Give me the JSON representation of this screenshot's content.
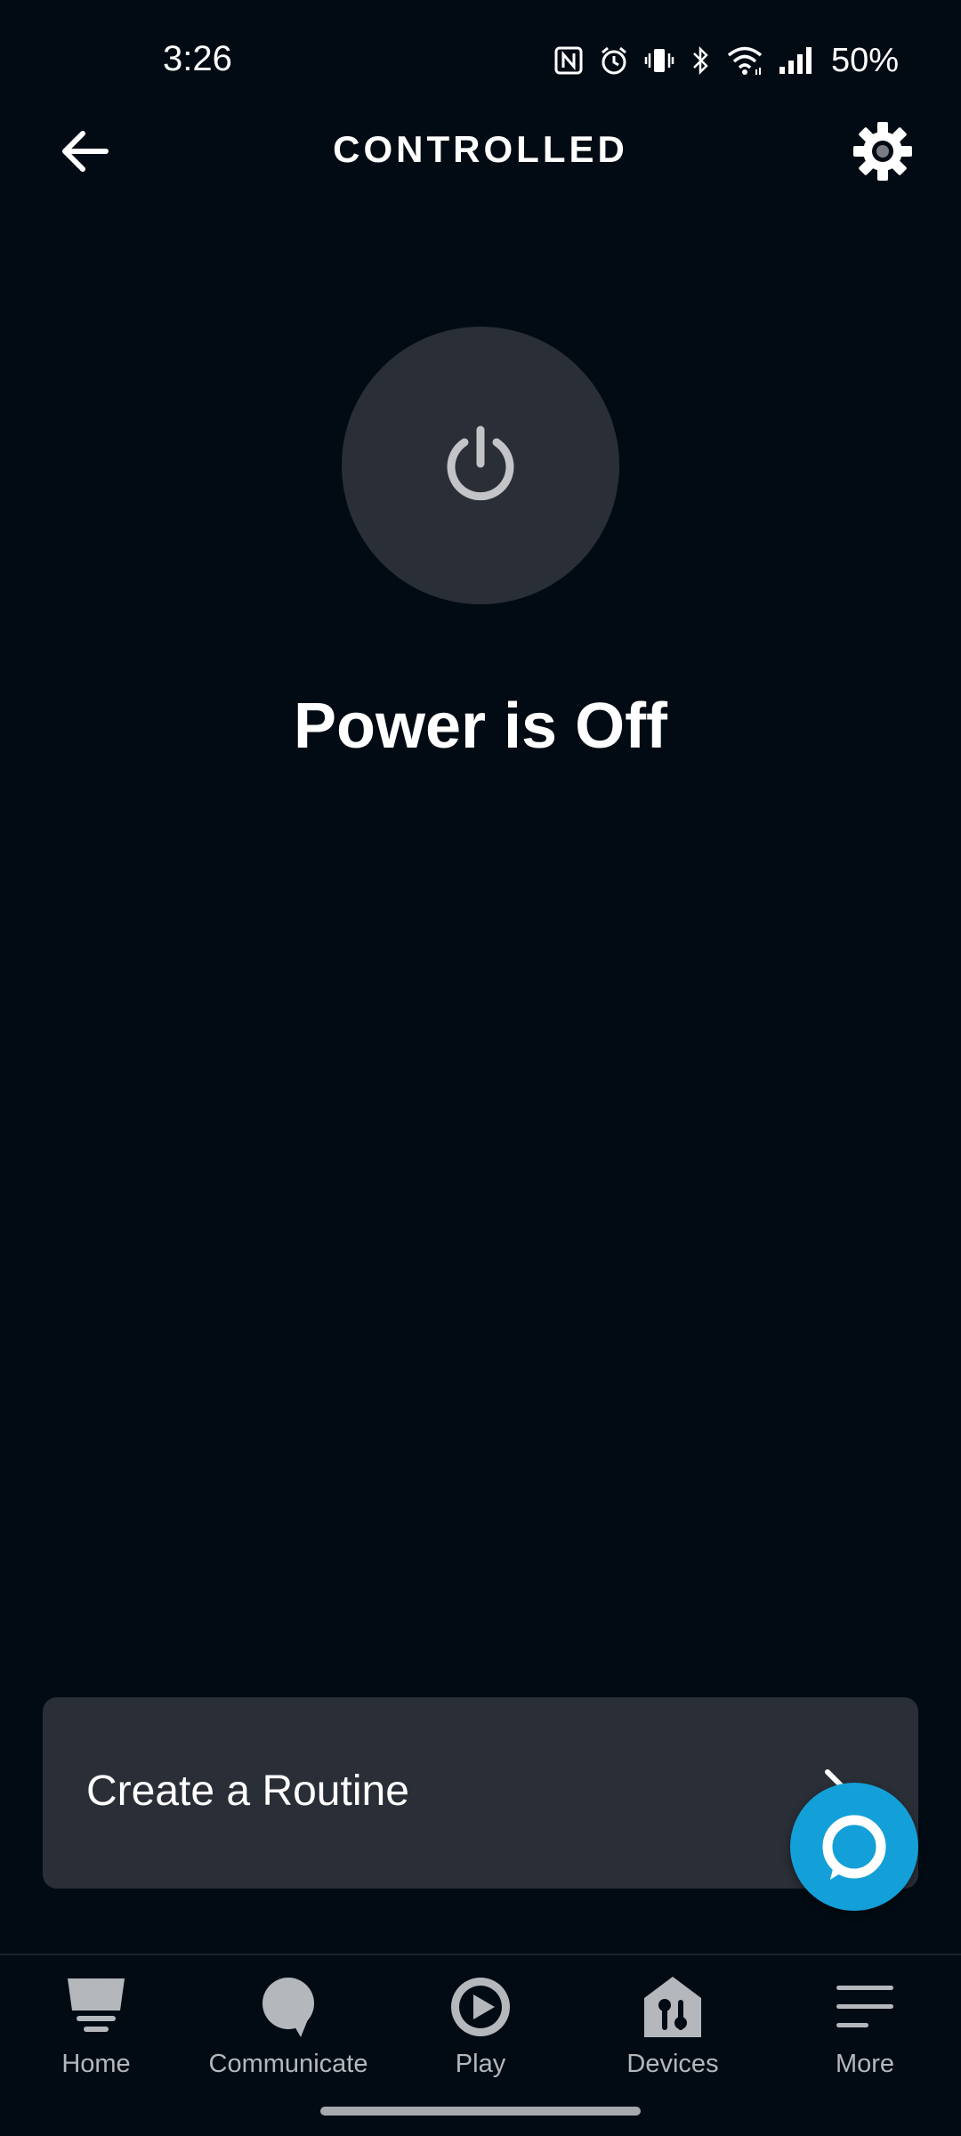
{
  "status_bar": {
    "time": "3:26",
    "battery": "50%",
    "icons": [
      "nfc-icon",
      "alarm-icon",
      "vibrate-icon",
      "bluetooth-icon",
      "wifi-icon",
      "signal-icon"
    ]
  },
  "header": {
    "title": "CONTROLLED",
    "back_icon": "back-arrow-icon",
    "settings_icon": "gear-icon"
  },
  "power": {
    "icon": "power-icon",
    "status": "Power is Off"
  },
  "routine_card": {
    "label": "Create a Routine",
    "chevron_icon": "chevron-right-icon"
  },
  "alexa_button": {
    "icon": "alexa-icon",
    "color": "#13a0d8"
  },
  "bottom_nav": {
    "items": [
      {
        "label": "Home",
        "icon": "home-icon"
      },
      {
        "label": "Communicate",
        "icon": "chat-bubble-icon"
      },
      {
        "label": "Play",
        "icon": "play-icon"
      },
      {
        "label": "Devices",
        "icon": "devices-icon"
      },
      {
        "label": "More",
        "icon": "menu-icon"
      }
    ]
  },
  "colors": {
    "background": "#020b13",
    "surface": "#2a2e36",
    "accent": "#13a0d8",
    "nav_inactive": "#b4b8bd"
  }
}
